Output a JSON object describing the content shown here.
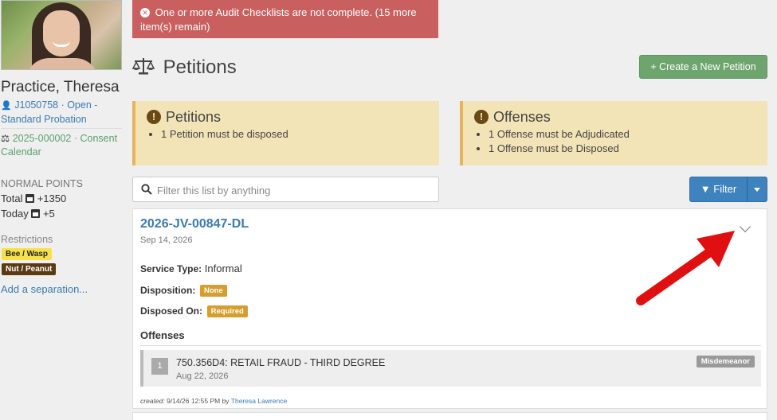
{
  "profile": {
    "name": "Practice, Theresa",
    "case_link": "J1050758 · Open - Standard Probation",
    "consent_link": "2025-000002 · Consent Calendar",
    "points_label": "NORMAL POINTS",
    "total_label": "Total",
    "total_value": "+1350",
    "today_label": "Today",
    "today_value": "+5",
    "restrictions_label": "Restrictions",
    "restrictions": [
      "Bee / Wasp",
      "Nut / Peanut"
    ],
    "add_separation": "Add a separation..."
  },
  "alert": {
    "text": "One or more Audit Checklists are not complete. (15 more item(s) remain)"
  },
  "page": {
    "title": "Petitions",
    "create_button": "+ Create a New Petition"
  },
  "warnings": {
    "petitions": {
      "title": "Petitions",
      "items": [
        "1 Petition must be disposed"
      ]
    },
    "offenses": {
      "title": "Offenses",
      "items": [
        "1 Offense must be Adjudicated",
        "1 Offense must be Disposed"
      ]
    }
  },
  "search": {
    "placeholder": "Filter this list by anything"
  },
  "filter": {
    "label": "Filter"
  },
  "petition": {
    "case_number": "2026-JV-00847-DL",
    "date": "Sep 14, 2026",
    "service_type_label": "Service Type:",
    "service_type_value": "Informal",
    "disposition_label": "Disposition:",
    "disposition_value": "None",
    "disposed_on_label": "Disposed On:",
    "disposed_on_value": "Required",
    "offenses_title": "Offenses",
    "offense": {
      "number": "1",
      "title": "750.356D4: RETAIL FRAUD - THIRD DEGREE",
      "date": "Aug 22, 2026",
      "class": "Misdemeanor"
    },
    "created_prefix": "created:",
    "created_date": "9/14/26 12:55 PM",
    "created_by_word": "by",
    "created_by": "Theresa Lawrence"
  },
  "colors": {
    "alert_bg": "#c9605f",
    "create_button": "#6ea46e",
    "filter_button": "#3f83be",
    "warning_bg": "#f3e4b8",
    "badge": "#d69e2e",
    "arrow": "#e01010"
  }
}
